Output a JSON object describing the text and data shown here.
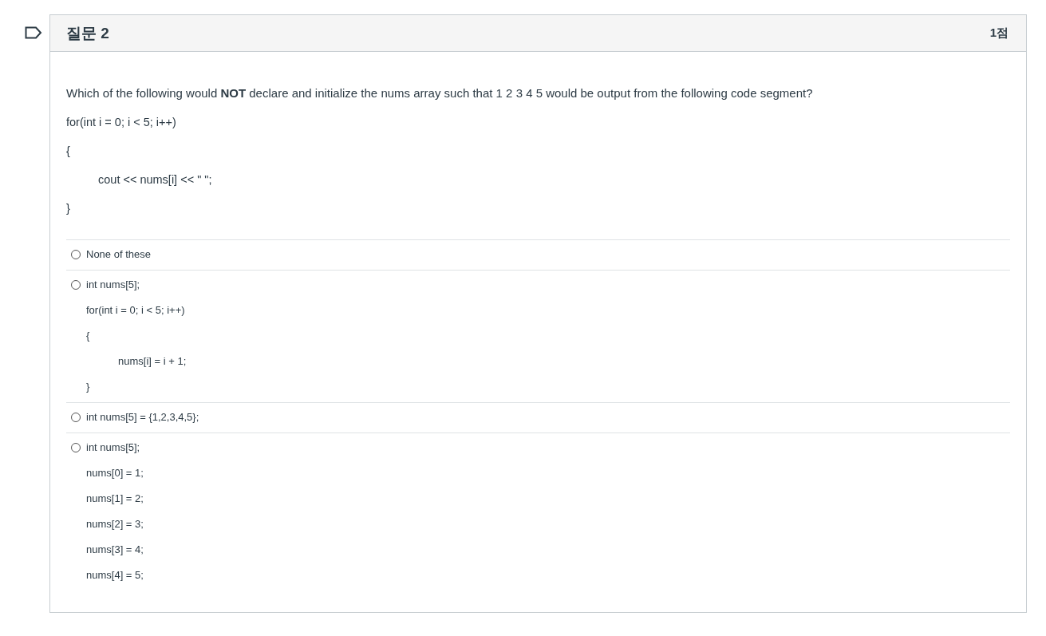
{
  "question": {
    "title": "질문 2",
    "points": "1점",
    "prompt": "Which of the following would **NOT** declare and initialize the nums array such that 1 2 3 4 5  would be output from the following code segment?",
    "code": [
      {
        "text": "for(int i = 0; i < 5; i++)",
        "kind": "line"
      },
      {
        "text": "{",
        "kind": "line"
      },
      {
        "text": "cout << nums[i] << \" \";",
        "kind": "indented"
      },
      {
        "text": "}",
        "kind": "line"
      }
    ]
  },
  "answers": [
    {
      "selected": false,
      "lines": [
        {
          "text": "None of these",
          "kind": "line"
        }
      ]
    },
    {
      "selected": false,
      "lines": [
        {
          "text": "int nums[5];",
          "kind": "line"
        },
        {
          "text": "for(int i = 0; i < 5; i++)",
          "kind": "line"
        },
        {
          "text": "{",
          "kind": "line"
        },
        {
          "text": "nums[i] = i + 1;",
          "kind": "indented"
        },
        {
          "text": "}",
          "kind": "line"
        }
      ]
    },
    {
      "selected": false,
      "lines": [
        {
          "text": "int nums[5] = {1,2,3,4,5};",
          "kind": "line"
        }
      ]
    },
    {
      "selected": false,
      "lines": [
        {
          "text": "int nums[5];",
          "kind": "line"
        },
        {
          "text": "nums[0] = 1;",
          "kind": "line"
        },
        {
          "text": "nums[1] = 2;",
          "kind": "line"
        },
        {
          "text": "nums[2] = 3;",
          "kind": "line"
        },
        {
          "text": "nums[3] = 4;",
          "kind": "line"
        },
        {
          "text": "nums[4] = 5;",
          "kind": "line"
        }
      ]
    }
  ]
}
